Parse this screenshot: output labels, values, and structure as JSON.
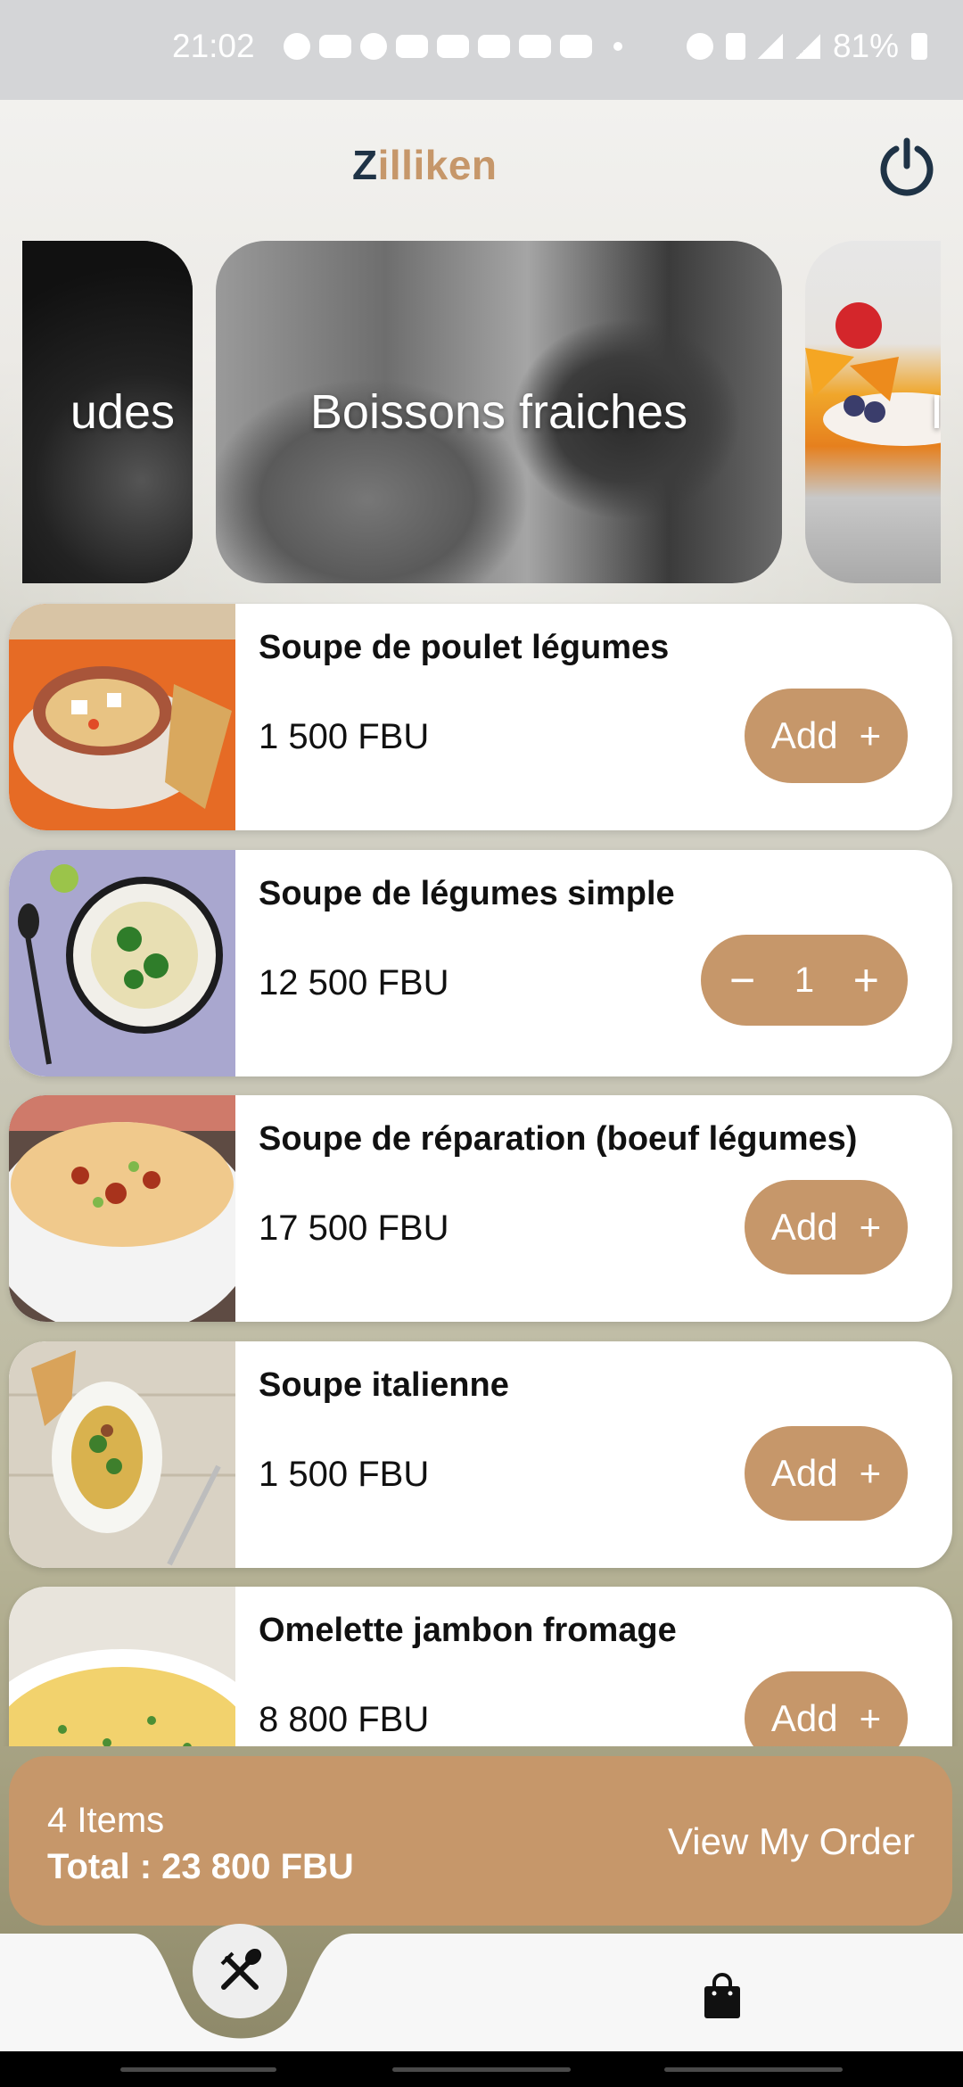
{
  "status_bar": {
    "time": "21:02",
    "battery": "81%"
  },
  "header": {
    "title_first": "Z",
    "title_rest": "illiken",
    "power_icon": "power-icon"
  },
  "categories": [
    {
      "label": "udes"
    },
    {
      "label": "Boissons fraiches"
    },
    {
      "label": "I"
    }
  ],
  "menu_items": [
    {
      "name": "Soupe de poulet légumes",
      "price": "1 500 FBU",
      "action": "Add",
      "action_icon": "+"
    },
    {
      "name": "Soupe de légumes simple",
      "price": "12 500 FBU",
      "quantity": "1",
      "minus": "−",
      "plus": "+"
    },
    {
      "name": "Soupe de réparation (boeuf légumes)",
      "price": "17 500 FBU",
      "action": "Add",
      "action_icon": "+"
    },
    {
      "name": "Soupe italienne",
      "price": "1 500 FBU",
      "action": "Add",
      "action_icon": "+"
    },
    {
      "name": "Omelette jambon fromage",
      "price": "8 800 FBU",
      "action": "Add",
      "action_icon": "+"
    }
  ],
  "order_bar": {
    "items": "4 Items",
    "total": "Total : 23 800 FBU",
    "view_label": "View My Order"
  },
  "bottom_nav": {
    "home_icon": "fork-spoon-icon",
    "cart_icon": "shopping-bag-icon"
  },
  "colors": {
    "accent": "#c6976a",
    "title_dark": "#1f3346"
  }
}
